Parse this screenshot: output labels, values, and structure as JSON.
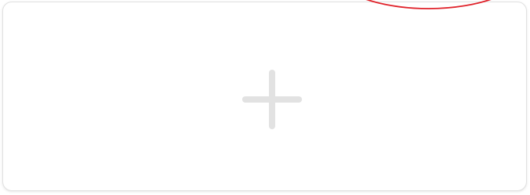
{
  "add_card": {
    "icon": "plus-icon"
  },
  "annotation": {
    "shape": "ellipse",
    "color": "#e0222a"
  },
  "colors": {
    "card_border": "#e1e1e1",
    "plus_icon": "#e2e2e2",
    "background": "#ffffff"
  }
}
